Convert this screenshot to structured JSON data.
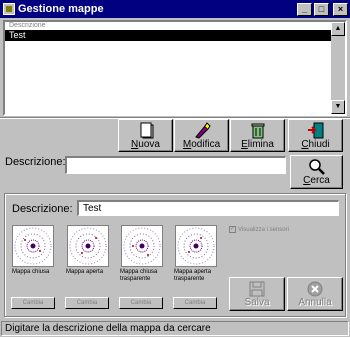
{
  "window": {
    "title": "Gestione mappe",
    "minimize": "_",
    "maximize": "□",
    "close": "×"
  },
  "list": {
    "column_header": "Descrizione",
    "items": [
      {
        "label": "Test",
        "selected": true
      }
    ]
  },
  "toolbar": {
    "nuova": "Nuova",
    "modifica": "Modifica",
    "elimina": "Elimina",
    "chiudi": "Chiudi"
  },
  "search": {
    "label": "Descrizione:",
    "value": "",
    "button": "Cerca"
  },
  "detail": {
    "label": "Descrizione:",
    "value": "Test",
    "checkbox_label": "Visualizza i sensori",
    "checkbox_checked": true,
    "maps": [
      {
        "caption": "Mappa chiusa",
        "button": "Cambia"
      },
      {
        "caption": "Mappa aperta",
        "button": "Cambia"
      },
      {
        "caption": "Mappa chiusa trasparente",
        "button": "Cambia"
      },
      {
        "caption": "Mappa aperta trasparente",
        "button": "Cambia"
      }
    ],
    "save": "Salva",
    "cancel": "Annulla"
  },
  "status": {
    "text": "Digitare la descrizione della mappa da cercare"
  }
}
